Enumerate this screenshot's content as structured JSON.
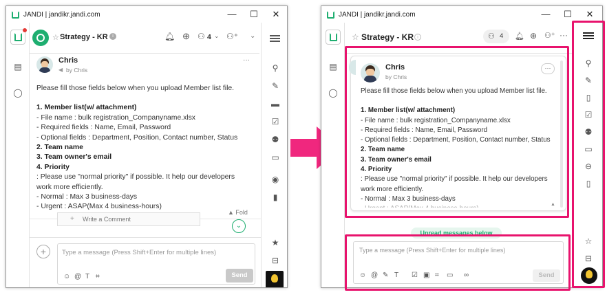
{
  "window": {
    "title": "JANDI | jandikr.jandi.com",
    "minimize": "—",
    "maximize": "☐",
    "close": "✕"
  },
  "topic": {
    "name": "Strategy - KR",
    "member_count": "4"
  },
  "message": {
    "author": "Chris",
    "by_line": "by Chris",
    "more": "···",
    "lines": [
      "Please fill those fields below when you upload Member list file.",
      "",
      "1. Member list(w/ attachment)",
      " - File name : bulk registration_Companyname.xlsx",
      " - Required fields : Name, Email, Password",
      " - Optional fields : Department, Position, Contact number, Status",
      "2. Team name",
      "3. Team owner's email",
      "4. Priority",
      "  : Please use \"normal priority\" if possible. It help our developers work more efficiently.",
      " - Normal : Max 3 business-days",
      " - Urgent : ASAP(Max 4 business-hours)"
    ],
    "fold": "▲ Fold",
    "write_comment": "Write a Comment"
  },
  "composer": {
    "placeholder": "Type a message (Press Shift+Enter for multiple lines)",
    "send": "Send"
  },
  "unread_banner": "Unread messages below",
  "colors": {
    "brand_green": "#1eae70",
    "highlight": "#e8136d",
    "arrow": "#f0277e"
  }
}
